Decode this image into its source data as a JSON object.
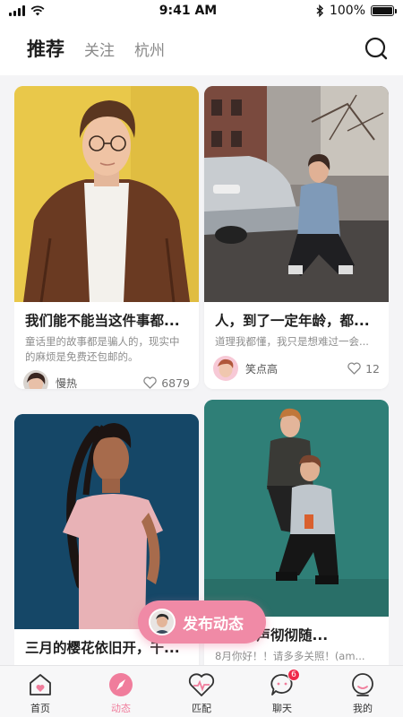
{
  "status_bar": {
    "time": "9:41 AM",
    "battery": "100%",
    "icons": [
      "signal-icon",
      "wifi-icon",
      "bluetooth-icon",
      "battery-icon"
    ]
  },
  "header": {
    "tabs": [
      {
        "label": "推荐",
        "active": true
      },
      {
        "label": "关注",
        "active": false
      },
      {
        "label": "杭州",
        "active": false
      }
    ],
    "search_icon": "search-icon"
  },
  "feed": {
    "cards": [
      {
        "title": "我们能不能当这件事都...",
        "desc": "童话里的故事都是骗人的，现实中的麻烦是免费还包邮的。",
        "author": "慢热",
        "likes": "6879",
        "photo": "man in brown leather jacket with glasses on yellow background"
      },
      {
        "title": "人，到了一定年龄，都...",
        "desc": "道理我都懂，我只是想难过一会...",
        "author": "笑点高",
        "likes": "12",
        "photo": "woman crouching on street beside car"
      },
      {
        "title": "三月的樱花依旧开，千...",
        "photo": "woman in pink t-shirt on dark blue background"
      },
      {
        "title": "纷，寒声彻彻随...",
        "desc": "8月你好！！请多多关照！(am...",
        "photo": "couple posing on teal background"
      }
    ]
  },
  "publish_button": {
    "label": "发布动态"
  },
  "tabbar": {
    "items": [
      {
        "label": "首页",
        "icon": "home-icon",
        "active": false
      },
      {
        "label": "动态",
        "icon": "compass-icon",
        "active": true
      },
      {
        "label": "匹配",
        "icon": "heart-pulse-icon",
        "active": false
      },
      {
        "label": "聊天",
        "icon": "chat-icon",
        "active": false,
        "badge": "6"
      },
      {
        "label": "我的",
        "icon": "profile-icon",
        "active": false
      }
    ]
  },
  "colors": {
    "accent": "#f07d9c",
    "badge": "#ef2a4a",
    "background": "#f4f4f6"
  }
}
